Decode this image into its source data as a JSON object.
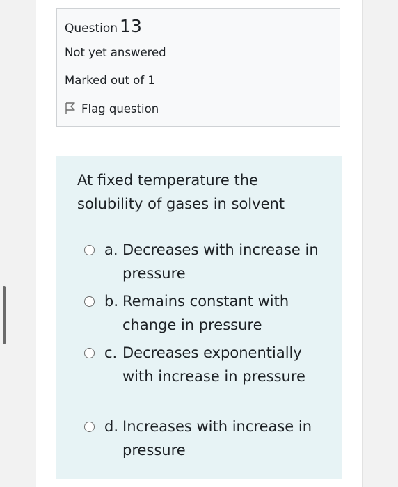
{
  "question_info": {
    "label": "Question",
    "number": "13",
    "state": "Not yet answered",
    "grade": "Marked out of 1",
    "flag_label": "Flag question"
  },
  "question": {
    "text": "At fixed temperature the solubility of gases in solvent",
    "options": [
      {
        "letter": "a.",
        "text": "Decreases with increase in pressure",
        "selected": false
      },
      {
        "letter": "b.",
        "text": "Remains constant with change in pressure",
        "selected": false
      },
      {
        "letter": "c.",
        "text": "Decreases exponentially with increase in pressure",
        "selected": false
      },
      {
        "letter": "d.",
        "text": "Increases with increase in pressure",
        "selected": false
      }
    ]
  },
  "colors": {
    "info_background": "#f8f9fa",
    "info_border": "#cfd2d5",
    "question_background": "#e7f3f5",
    "text": "#1d2125"
  }
}
